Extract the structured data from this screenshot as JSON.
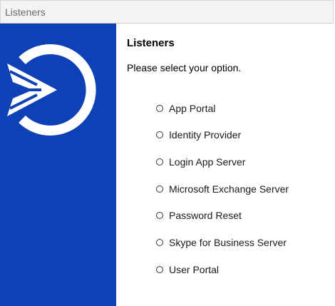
{
  "window": {
    "title": "Listeners"
  },
  "logo": {
    "icon": "sign-in-arrow-circle-icon",
    "color": "#ffffff",
    "background": "#0f41b6"
  },
  "main": {
    "heading": "Listeners",
    "prompt": "Please select your option.",
    "options": [
      {
        "label": "App Portal",
        "selected": false
      },
      {
        "label": "Identity Provider",
        "selected": false
      },
      {
        "label": "Login App Server",
        "selected": false
      },
      {
        "label": "Microsoft Exchange Server",
        "selected": false
      },
      {
        "label": "Password Reset",
        "selected": false
      },
      {
        "label": "Skype for Business Server",
        "selected": false
      },
      {
        "label": "User Portal",
        "selected": false
      }
    ]
  }
}
